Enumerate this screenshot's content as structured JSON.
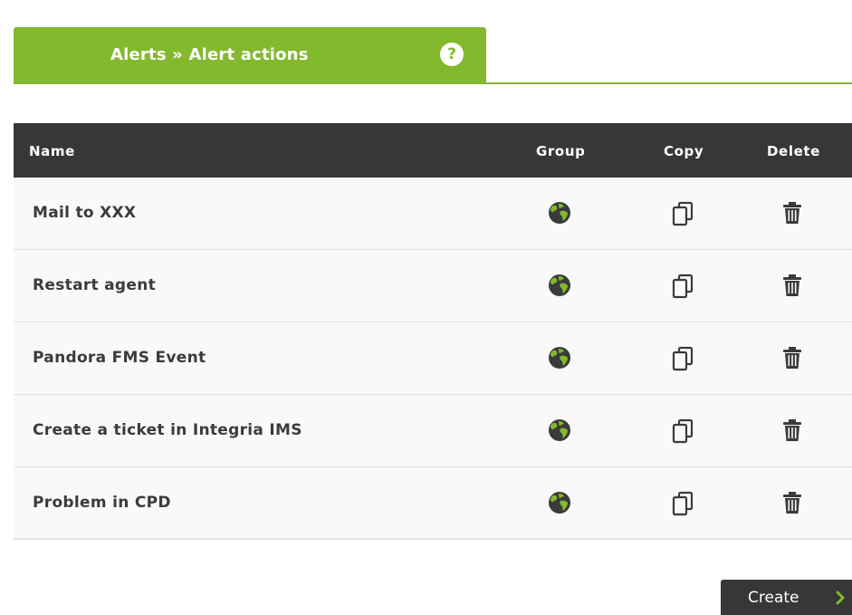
{
  "header": {
    "title": "Alerts » Alert actions",
    "help_icon": "help-question-icon"
  },
  "table": {
    "columns": {
      "name": "Name",
      "group": "Group",
      "copy": "Copy",
      "delete": "Delete"
    },
    "rows": [
      {
        "name": "Mail to XXX",
        "group_icon": "globe-icon",
        "copy_icon": "copy-icon",
        "delete_icon": "trash-icon"
      },
      {
        "name": "Restart agent",
        "group_icon": "globe-icon",
        "copy_icon": "copy-icon",
        "delete_icon": "trash-icon"
      },
      {
        "name": "Pandora FMS Event",
        "group_icon": "globe-icon",
        "copy_icon": "copy-icon",
        "delete_icon": "trash-icon"
      },
      {
        "name": "Create a ticket in Integria IMS",
        "group_icon": "globe-icon",
        "copy_icon": "copy-icon",
        "delete_icon": "trash-icon"
      },
      {
        "name": "Problem in CPD",
        "group_icon": "globe-icon",
        "copy_icon": "copy-icon",
        "delete_icon": "trash-icon"
      }
    ]
  },
  "actions": {
    "create_label": "Create"
  },
  "colors": {
    "accent": "#82b92e",
    "header_dark": "#373737",
    "row_bg": "#f9f9f9"
  }
}
